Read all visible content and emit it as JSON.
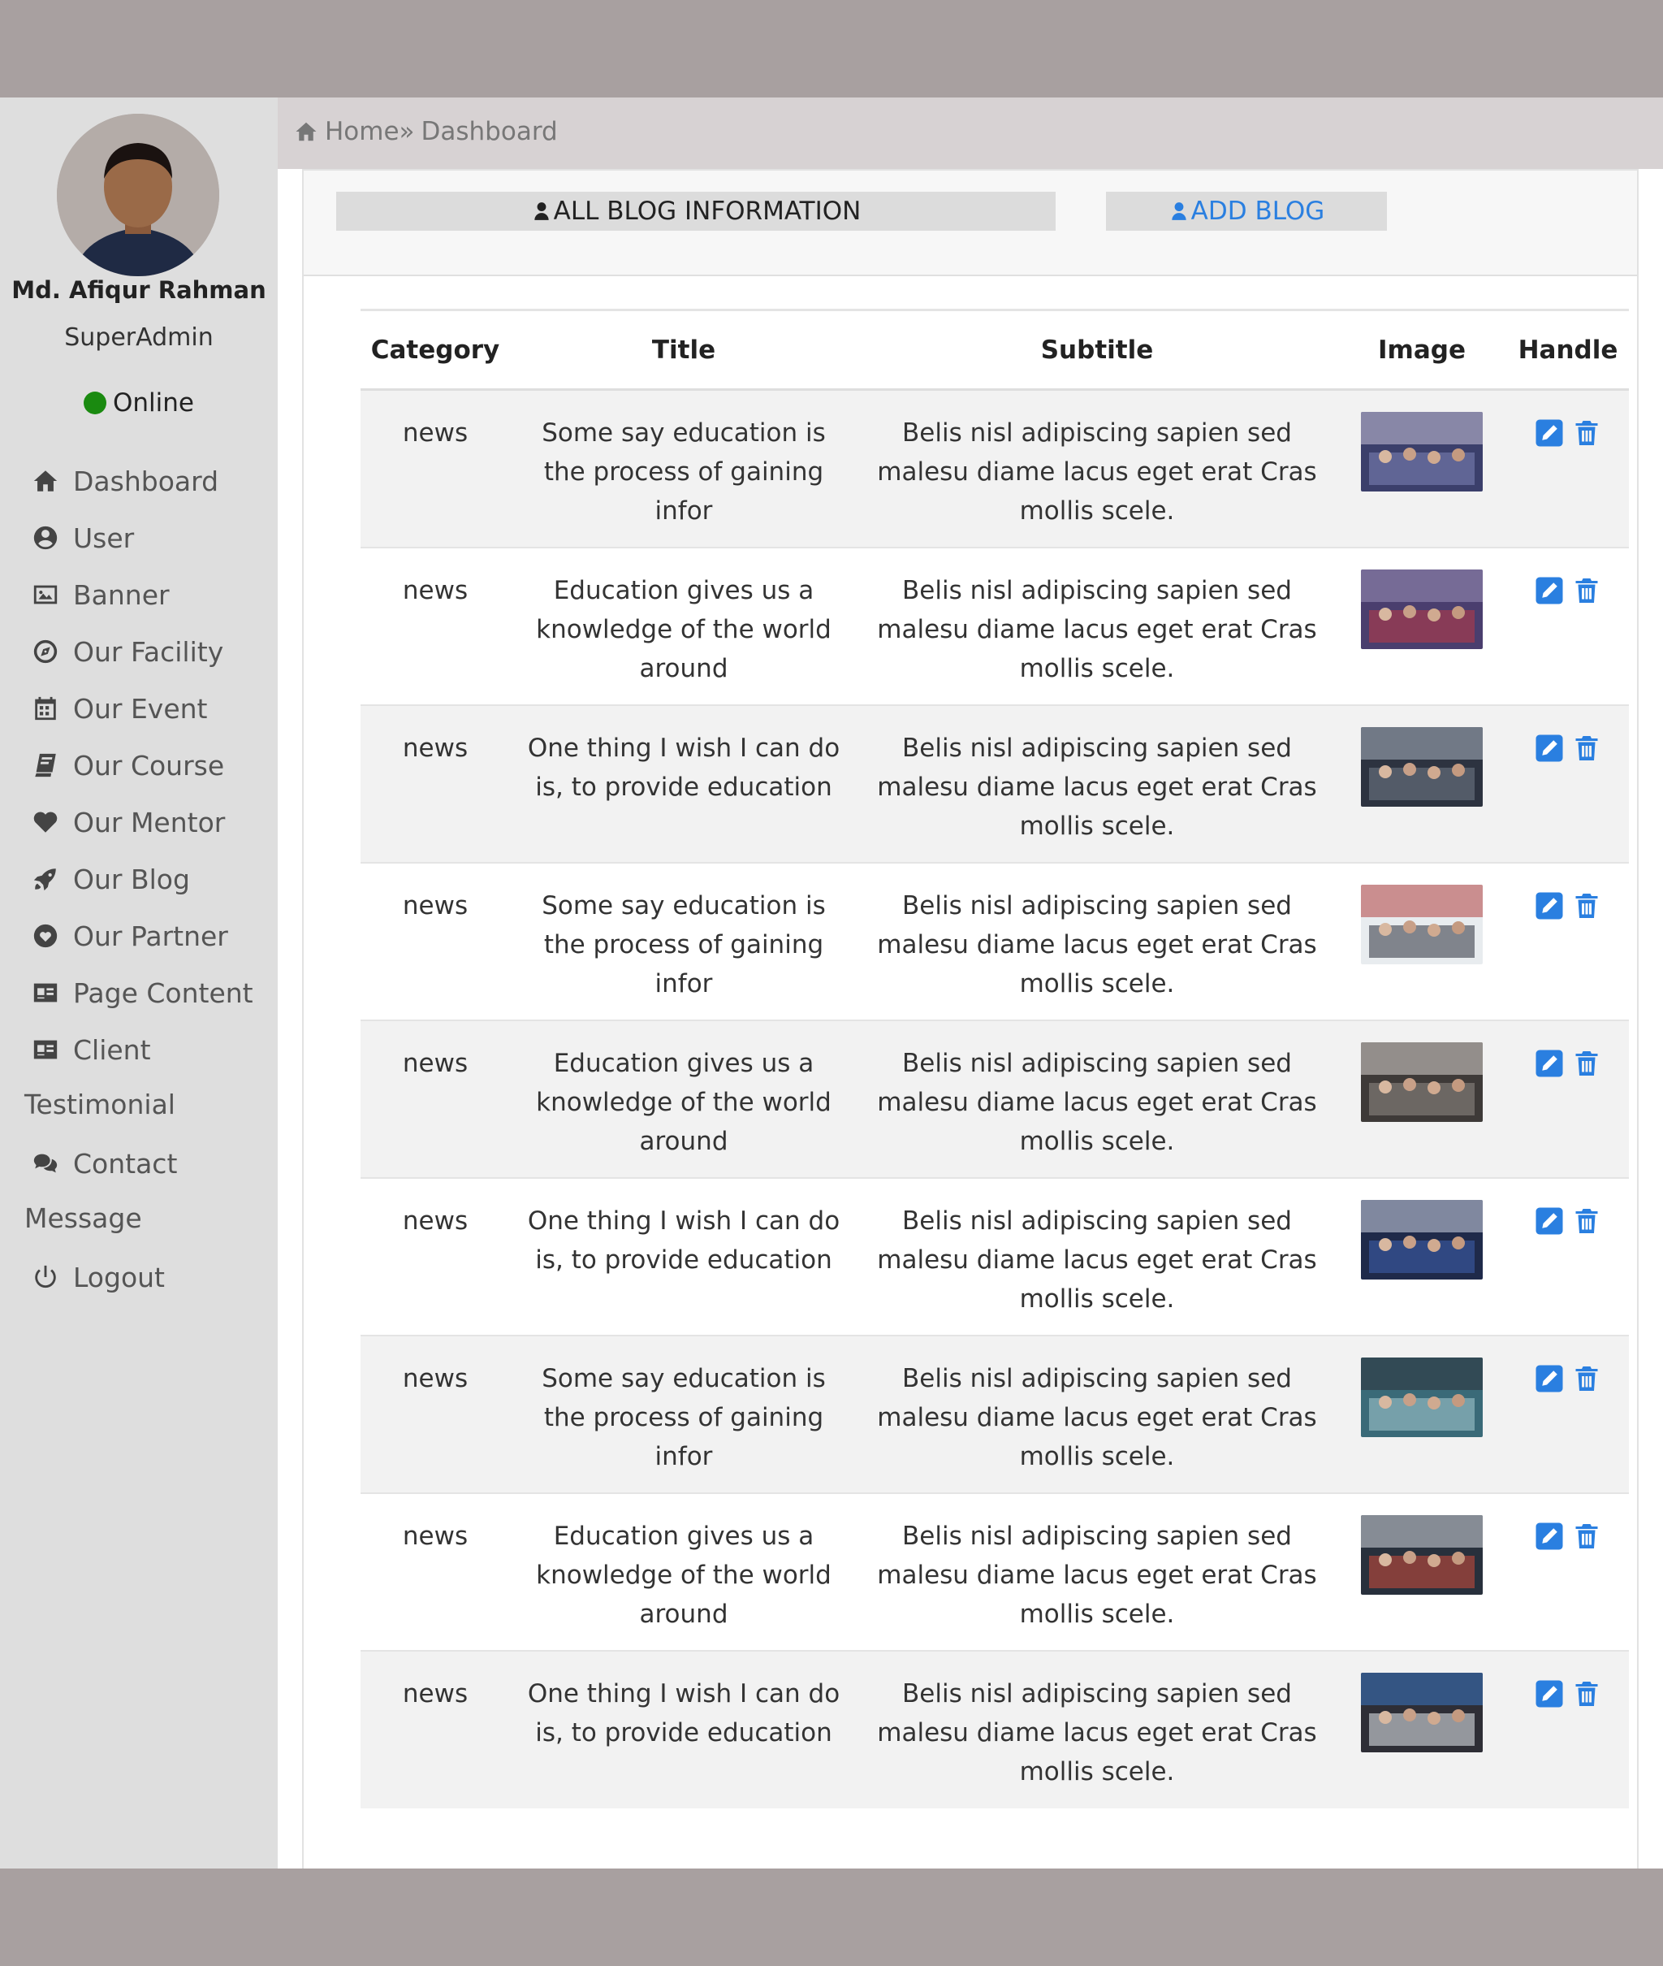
{
  "profile": {
    "name": "Md. Afiqur Rahman",
    "role": "SuperAdmin",
    "status": "Online"
  },
  "sidebar": {
    "items": [
      {
        "label": "Dashboard",
        "icon": "home-icon"
      },
      {
        "label": "User",
        "icon": "user-circle-icon"
      },
      {
        "label": "Banner",
        "icon": "image-icon"
      },
      {
        "label": "Our Facility",
        "icon": "compass-icon"
      },
      {
        "label": "Our Event",
        "icon": "calendar-icon"
      },
      {
        "label": "Our Course",
        "icon": "book-icon"
      },
      {
        "label": "Our Mentor",
        "icon": "heart-icon"
      },
      {
        "label": "Our Blog",
        "icon": "rocket-icon"
      },
      {
        "label": "Our Partner",
        "icon": "heart-circle-icon"
      },
      {
        "label": "Page Content",
        "icon": "id-card-icon"
      },
      {
        "label": "Client",
        "icon": "id-card-icon"
      },
      {
        "label": "Testimonial",
        "icon": ""
      },
      {
        "label": "Contact",
        "icon": "comments-icon"
      },
      {
        "label": "Message",
        "icon": ""
      },
      {
        "label": "Logout",
        "icon": "power-icon"
      }
    ]
  },
  "breadcrumb": {
    "home": "Home",
    "separator": "»",
    "current": "Dashboard"
  },
  "tabs": {
    "all_label": "ALL BLOG INFORMATION",
    "add_label": "ADD BLOG"
  },
  "table": {
    "headers": [
      "Category",
      "Title",
      "Subtitle",
      "Image",
      "Handle"
    ],
    "rows": [
      {
        "category": "news",
        "title": "Some say education is the process of gaining infor",
        "subtitle": "Belis nisl adipiscing sapien sed malesu diame lacus eget erat Cras mollis scele."
      },
      {
        "category": "news",
        "title": "Education gives us a knowledge of the world around",
        "subtitle": "Belis nisl adipiscing sapien sed malesu diame lacus eget erat Cras mollis scele."
      },
      {
        "category": "news",
        "title": "One thing I wish I can do is, to provide education",
        "subtitle": "Belis nisl adipiscing sapien sed malesu diame lacus eget erat Cras mollis scele."
      },
      {
        "category": "news",
        "title": "Some say education is the process of gaining infor",
        "subtitle": "Belis nisl adipiscing sapien sed malesu diame lacus eget erat Cras mollis scele."
      },
      {
        "category": "news",
        "title": "Education gives us a knowledge of the world around",
        "subtitle": "Belis nisl adipiscing sapien sed malesu diame lacus eget erat Cras mollis scele."
      },
      {
        "category": "news",
        "title": "One thing I wish I can do is, to provide education",
        "subtitle": "Belis nisl adipiscing sapien sed malesu diame lacus eget erat Cras mollis scele."
      },
      {
        "category": "news",
        "title": "Some say education is the process of gaining infor",
        "subtitle": "Belis nisl adipiscing sapien sed malesu diame lacus eget erat Cras mollis scele."
      },
      {
        "category": "news",
        "title": "Education gives us a knowledge of the world around",
        "subtitle": "Belis nisl adipiscing sapien sed malesu diame lacus eget erat Cras mollis scele."
      },
      {
        "category": "news",
        "title": "One thing I wish I can do is, to provide education",
        "subtitle": "Belis nisl adipiscing sapien sed malesu diame lacus eget erat Cras mollis scele."
      }
    ]
  },
  "colors": {
    "accent": "#2a7fe0",
    "online": "#1a8a10",
    "sidebar_bg": "#dedede",
    "frame_bg": "#a8a0a0"
  }
}
